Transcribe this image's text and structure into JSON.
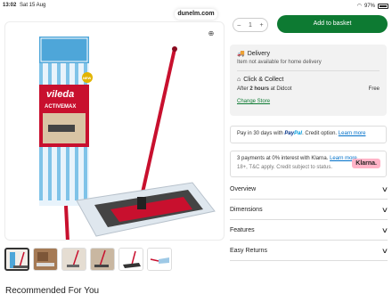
{
  "status_bar": {
    "time": "13:02",
    "date": "Sat 15 Aug",
    "battery": "97%"
  },
  "browser": {
    "url": "dunelm.com"
  },
  "product_image": {
    "brand": "vileda",
    "product_line": "ACTIVEMAX",
    "badge": "NEW"
  },
  "purchase": {
    "qty_minus": "–",
    "qty_value": "1",
    "qty_plus": "+",
    "add_to_basket": "Add to basket"
  },
  "delivery": {
    "title": "Delivery",
    "subtitle": "Item not available for home delivery",
    "cc_title": "Click & Collect",
    "cc_after": "After ",
    "cc_hours": "2 hours",
    "cc_at": " at Didcot",
    "cc_price": "Free",
    "change_store": "Change Store"
  },
  "paypal": {
    "prefix": "Pay in 30 days with",
    "brand1": "Pay",
    "brand2": "Pal",
    "suffix": ". Credit option.",
    "link": "Learn more"
  },
  "klarna": {
    "text": "3 payments at 0% interest with Klarna.",
    "link": "Learn more",
    "line2": "18+, T&C apply. Credit subject to status.",
    "badge": "Klarna."
  },
  "accordion": [
    "Overview",
    "Dimensions",
    "Features",
    "Easy Returns"
  ],
  "recommended_title": "Recommended For You",
  "colors": {
    "accent": "#0d7a32",
    "mop_red": "#c8102e",
    "link": "#0070c9"
  }
}
